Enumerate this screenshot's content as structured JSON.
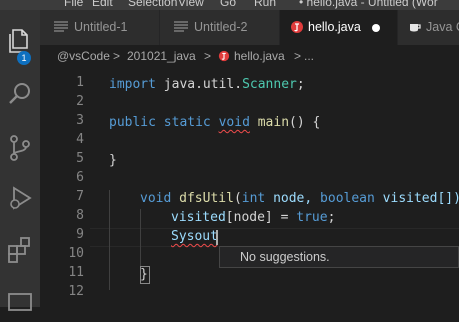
{
  "menu": {
    "items": [
      "File",
      "Edit",
      "Selection",
      "View",
      "Go",
      "Run"
    ],
    "window_title": "• hello.java - Untitled (Wor"
  },
  "activity_bar": {
    "icons": [
      "explorer-icon",
      "search-icon",
      "source-control-icon",
      "run-debug-icon",
      "extensions-icon",
      "remote-icon"
    ],
    "explorer_badge": "1"
  },
  "tabs": [
    {
      "label": "Untitled-1",
      "icon": "lines-icon",
      "active": false
    },
    {
      "label": "Untitled-2",
      "icon": "lines-icon",
      "active": false
    },
    {
      "label": "hello.java",
      "icon": "java-icon",
      "active": true,
      "dirty": true
    },
    {
      "label": "Java C",
      "icon": "coffee-icon",
      "active": false
    }
  ],
  "breadcrumb": {
    "root": "@vsCode",
    "sep1": ">",
    "folder": "201021_java",
    "sep2": ">",
    "file": "hello.java",
    "sep3": ">",
    "more": "..."
  },
  "editor": {
    "line_numbers": [
      "1",
      "2",
      "3",
      "4",
      "5",
      "6",
      "7",
      "8",
      "9",
      "10",
      "11",
      "12"
    ],
    "lines": [
      {
        "t1": "import",
        "t2": " java.util.",
        "t3": "Scanner",
        "t4": ";"
      },
      {},
      {
        "t1": "public",
        "t2": "static",
        "t3": "void",
        "t4": "main",
        "t5": "() {"
      },
      {},
      {
        "t1": "}"
      },
      {},
      {
        "t1": "void",
        "t2": "dfsUtil",
        "t3": "(",
        "t4": "int",
        "t5": "node, ",
        "t6": "boolean",
        "t7": "visited[])"
      },
      {
        "t1": "visited",
        "t2": "[node] = ",
        "t3": "true",
        "t4": ";"
      },
      {
        "t1": "Sysout"
      },
      {},
      {
        "t1": "}"
      },
      {}
    ]
  },
  "suggest_widget": {
    "message": "No suggestions."
  },
  "colors": {
    "background": "#1e1e1e",
    "activity_bar": "#333333",
    "keyword": "#569cd6",
    "function": "#dcdcaa",
    "type": "#4ec9b0",
    "variable": "#9cdcfe",
    "error_squiggle": "#f14c4c",
    "badge": "#0e70c0"
  }
}
